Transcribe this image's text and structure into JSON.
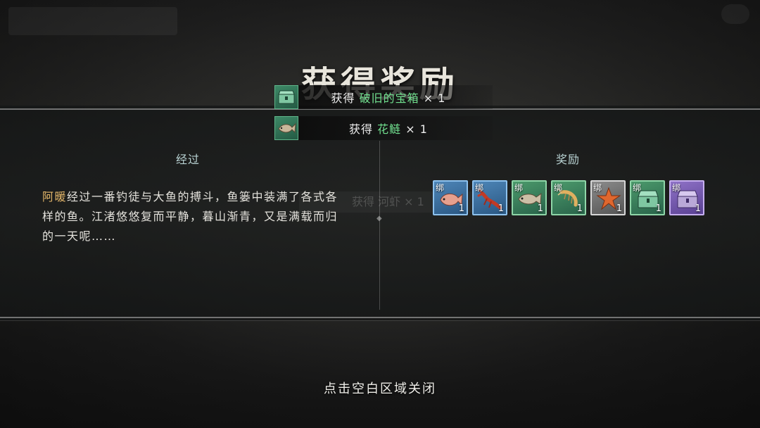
{
  "title": "获得奖励",
  "notices": [
    {
      "prefix": "获得",
      "item": "破旧的宝箱",
      "qty": "× 1",
      "icon": "chest-icon"
    },
    {
      "prefix": "获得",
      "item": "花鲢",
      "qty": "× 1",
      "icon": "fish-icon"
    }
  ],
  "ghost_notice": {
    "text": "获得 河虾 × 1"
  },
  "left_section": {
    "heading": "经过",
    "name": "阿暖",
    "story": "经过一番钓徒与大鱼的搏斗，鱼篓中装满了各式各样的鱼。江渚悠悠复而平静，暮山渐青，又是满载而归的一天呢……"
  },
  "right_section": {
    "heading": "奖励",
    "items": [
      {
        "icon": "red-fish-icon",
        "bind": "绑",
        "count": "1",
        "rarity": "blue"
      },
      {
        "icon": "crayfish-icon",
        "bind": "绑",
        "count": "1",
        "rarity": "blue"
      },
      {
        "icon": "bighead-carp-icon",
        "bind": "绑",
        "count": "1",
        "rarity": "green"
      },
      {
        "icon": "shrimp-icon",
        "bind": "绑",
        "count": "1",
        "rarity": "green"
      },
      {
        "icon": "starfish-icon",
        "bind": "绑",
        "count": "1",
        "rarity": "white"
      },
      {
        "icon": "green-chest-icon",
        "bind": "绑",
        "count": "1",
        "rarity": "green"
      },
      {
        "icon": "purple-chest-icon",
        "bind": "绑",
        "count": "1",
        "rarity": "purple"
      }
    ]
  },
  "close_hint": "点击空白区域关闭"
}
